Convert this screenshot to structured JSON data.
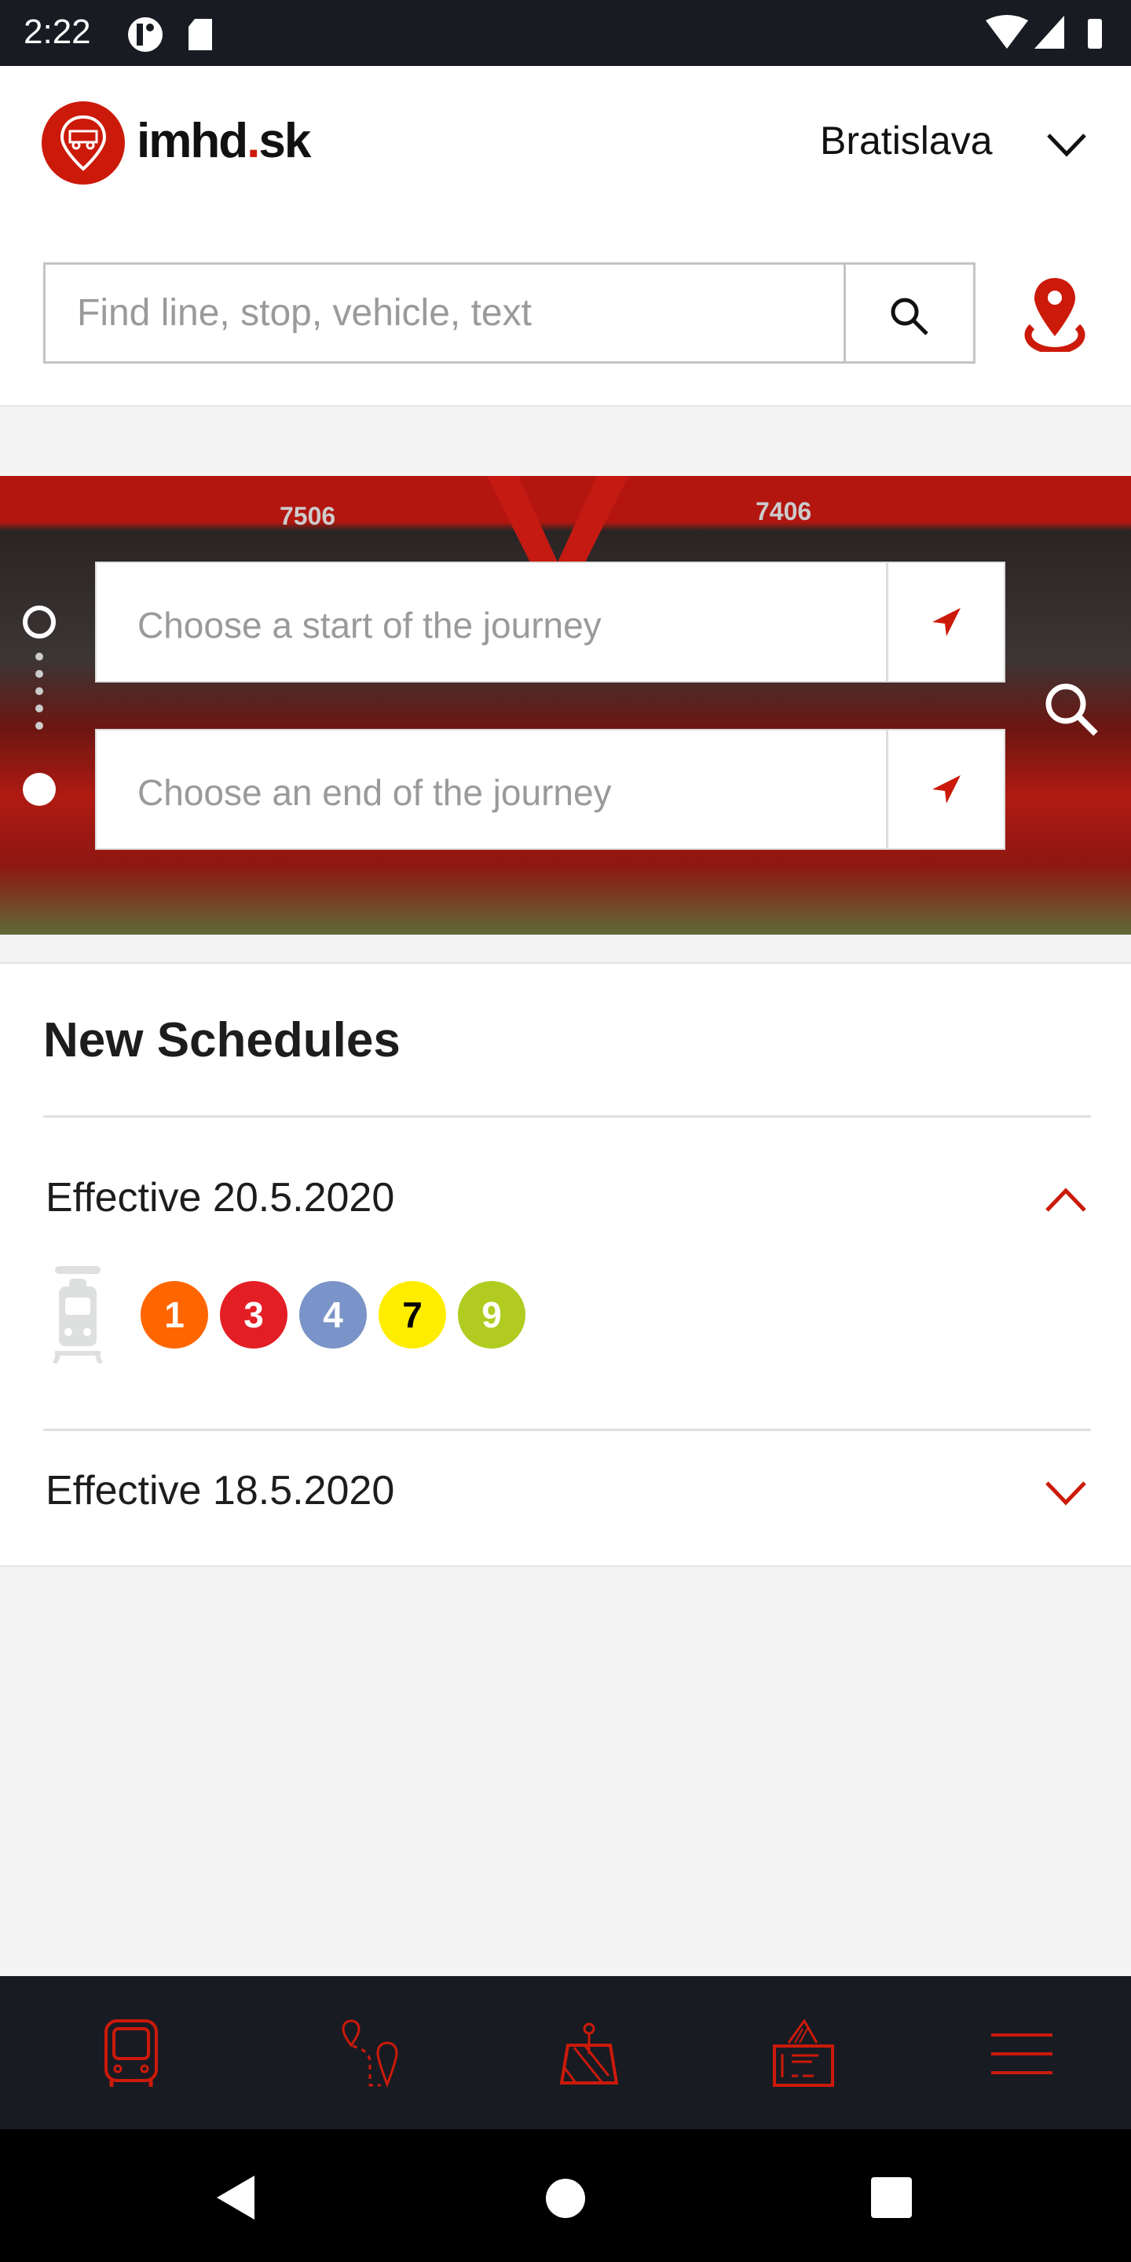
{
  "status_bar": {
    "time": "2:22"
  },
  "header": {
    "logo_text_main": "imhd",
    "logo_text_dot": ".",
    "logo_text_tld": "sk",
    "city": "Bratislava",
    "search_placeholder": "Find line, stop, vehicle, text"
  },
  "journey": {
    "start_placeholder": "Choose a start of the journey",
    "end_placeholder": "Choose an end of the journey"
  },
  "schedules": {
    "title": "New Schedules",
    "groups": [
      {
        "label": "Effective 20.5.2020",
        "expanded": true,
        "vehicle": "tram-icon",
        "lines": [
          {
            "number": "1",
            "color": "#ff6600",
            "text_color": "#ffffff"
          },
          {
            "number": "3",
            "color": "#e31e24",
            "text_color": "#ffffff"
          },
          {
            "number": "4",
            "color": "#7a93c8",
            "text_color": "#ffffff"
          },
          {
            "number": "7",
            "color": "#ffed00",
            "text_color": "#000000"
          },
          {
            "number": "9",
            "color": "#b1cb21",
            "text_color": "#ffffff"
          }
        ]
      },
      {
        "label": "Effective 18.5.2020",
        "expanded": false
      }
    ]
  },
  "bottom_nav": [
    "bus-icon",
    "route-icon",
    "map-icon",
    "ticket-icon",
    "menu-icon"
  ],
  "colors": {
    "brand": "#cc1a0a",
    "dark": "#191b23"
  }
}
